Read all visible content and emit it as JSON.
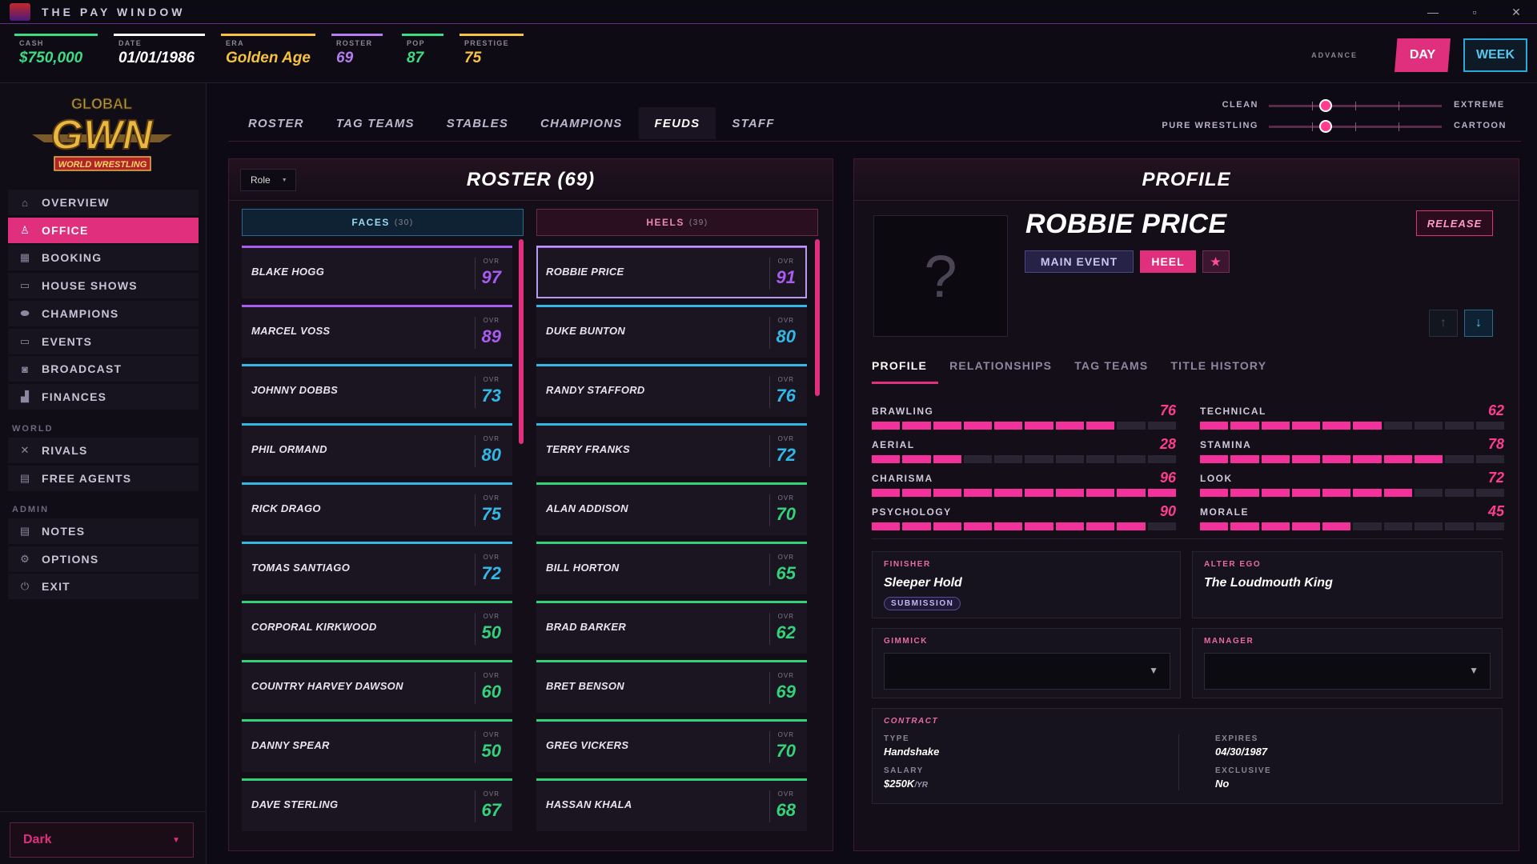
{
  "window": {
    "title": "THE PAY WINDOW"
  },
  "stats": [
    {
      "label": "CASH",
      "value": "$750,000",
      "color": "#3ddc84"
    },
    {
      "label": "DATE",
      "value": "01/01/1986",
      "color": "#ffffff"
    },
    {
      "label": "ERA",
      "value": "Golden Age",
      "color": "#f5c242"
    },
    {
      "label": "ROSTER",
      "value": "69",
      "color": "#b77cf0"
    },
    {
      "label": "POP",
      "value": "87",
      "color": "#3ddc84"
    },
    {
      "label": "PRESTIGE",
      "value": "75",
      "color": "#f5c242"
    }
  ],
  "advance": {
    "label": "ADVANCE",
    "day": "DAY",
    "week": "WEEK"
  },
  "brand": {
    "top": "GLOBAL",
    "main": "GWN",
    "sub": "WORLD WRESTLING"
  },
  "nav": [
    {
      "label": "OVERVIEW",
      "icon": "home-icon",
      "glyph": "⌂"
    },
    {
      "label": "OFFICE",
      "icon": "person-icon",
      "glyph": "♙",
      "active": true
    },
    {
      "label": "BOOKING",
      "icon": "calendar-icon",
      "glyph": "▦"
    },
    {
      "label": "HOUSE SHOWS",
      "icon": "ticket-icon",
      "glyph": "▭"
    },
    {
      "label": "CHAMPIONS",
      "icon": "belt-icon",
      "glyph": "⬬"
    },
    {
      "label": "EVENTS",
      "icon": "monitor-icon",
      "glyph": "▭"
    },
    {
      "label": "BROADCAST",
      "icon": "camera-icon",
      "glyph": "◙"
    },
    {
      "label": "FINANCES",
      "icon": "chart-icon",
      "glyph": "▟"
    }
  ],
  "world_label": "WORLD",
  "world_nav": [
    {
      "label": "RIVALS",
      "icon": "rivals-icon",
      "glyph": "✕"
    },
    {
      "label": "FREE AGENTS",
      "icon": "document-icon",
      "glyph": "▤"
    }
  ],
  "admin_label": "ADMIN",
  "admin_nav": [
    {
      "label": "NOTES",
      "icon": "notes-icon",
      "glyph": "▤"
    },
    {
      "label": "OPTIONS",
      "icon": "gear-icon",
      "glyph": "⚙"
    },
    {
      "label": "EXIT",
      "icon": "power-icon",
      "glyph": "⏻"
    }
  ],
  "theme": {
    "value": "Dark"
  },
  "tabs": [
    "ROSTER",
    "TAG TEAMS",
    "STABLES",
    "CHAMPIONS",
    "FEUDS",
    "STAFF"
  ],
  "selected_tab": "FEUDS",
  "sliders": [
    {
      "left": "CLEAN",
      "right": "EXTREME",
      "value": 0.33
    },
    {
      "left": "PURE WRESTLING",
      "right": "CARTOON",
      "value": 0.33
    }
  ],
  "roster": {
    "title": "ROSTER (69)",
    "role_filter": "Role",
    "ovr_label": "OVR",
    "faces": {
      "label": "FACES",
      "count": "(30)"
    },
    "heels": {
      "label": "HEELS",
      "count": "(39)"
    },
    "face_list": [
      {
        "name": "BLAKE HOGG",
        "ovr": "97",
        "tier": "#a85cf0"
      },
      {
        "name": "MARCEL VOSS",
        "ovr": "89",
        "tier": "#a85cf0"
      },
      {
        "name": "JOHNNY DOBBS",
        "ovr": "73",
        "tier": "#32b8e6"
      },
      {
        "name": "PHIL ORMAND",
        "ovr": "80",
        "tier": "#32b8e6"
      },
      {
        "name": "RICK DRAGO",
        "ovr": "75",
        "tier": "#32b8e6"
      },
      {
        "name": "TOMAS SANTIAGO",
        "ovr": "72",
        "tier": "#32b8e6"
      },
      {
        "name": "CORPORAL KIRKWOOD",
        "ovr": "50",
        "tier": "#33d27a"
      },
      {
        "name": "COUNTRY HARVEY DAWSON",
        "ovr": "60",
        "tier": "#33d27a"
      },
      {
        "name": "DANNY SPEAR",
        "ovr": "50",
        "tier": "#33d27a"
      },
      {
        "name": "DAVE STERLING",
        "ovr": "67",
        "tier": "#33d27a"
      }
    ],
    "heel_list": [
      {
        "name": "ROBBIE PRICE",
        "ovr": "91",
        "tier": "#a85cf0",
        "selected": true
      },
      {
        "name": "DUKE BUNTON",
        "ovr": "80",
        "tier": "#32b8e6"
      },
      {
        "name": "RANDY STAFFORD",
        "ovr": "76",
        "tier": "#32b8e6"
      },
      {
        "name": "TERRY FRANKS",
        "ovr": "72",
        "tier": "#32b8e6"
      },
      {
        "name": "ALAN ADDISON",
        "ovr": "70",
        "tier": "#33d27a"
      },
      {
        "name": "BILL HORTON",
        "ovr": "65",
        "tier": "#33d27a"
      },
      {
        "name": "BRAD BARKER",
        "ovr": "62",
        "tier": "#33d27a"
      },
      {
        "name": "BRET BENSON",
        "ovr": "69",
        "tier": "#33d27a"
      },
      {
        "name": "GREG VICKERS",
        "ovr": "70",
        "tier": "#33d27a"
      },
      {
        "name": "HASSAN KHALA",
        "ovr": "68",
        "tier": "#33d27a"
      }
    ]
  },
  "profile": {
    "title": "PROFILE",
    "photo_placeholder": "?",
    "name": "ROBBIE PRICE",
    "badges": {
      "card": "MAIN EVENT",
      "alignment": "HEEL",
      "star": "★"
    },
    "release": "RELEASE",
    "tabs": [
      "PROFILE",
      "RELATIONSHIPS",
      "TAG TEAMS",
      "TITLE HISTORY"
    ],
    "attributes": [
      {
        "name": "BRAWLING",
        "value": 76
      },
      {
        "name": "TECHNICAL",
        "value": 62
      },
      {
        "name": "AERIAL",
        "value": 28
      },
      {
        "name": "STAMINA",
        "value": 78
      },
      {
        "name": "CHARISMA",
        "value": 96
      },
      {
        "name": "LOOK",
        "value": 72
      },
      {
        "name": "PSYCHOLOGY",
        "value": 90
      },
      {
        "name": "MORALE",
        "value": 45
      }
    ],
    "finisher": {
      "label": "FINISHER",
      "value": "Sleeper Hold",
      "type": "SUBMISSION"
    },
    "alter_ego": {
      "label": "ALTER EGO",
      "value": "The Loudmouth King"
    },
    "gimmick": {
      "label": "GIMMICK",
      "value": ""
    },
    "manager": {
      "label": "MANAGER",
      "value": ""
    },
    "contract": {
      "label": "CONTRACT",
      "type_label": "TYPE",
      "type": "Handshake",
      "salary_label": "SALARY",
      "salary": "$250K",
      "salary_unit": "/YR",
      "expires_label": "EXPIRES",
      "expires": "04/30/1987",
      "exclusive_label": "EXCLUSIVE",
      "exclusive": "No"
    }
  }
}
